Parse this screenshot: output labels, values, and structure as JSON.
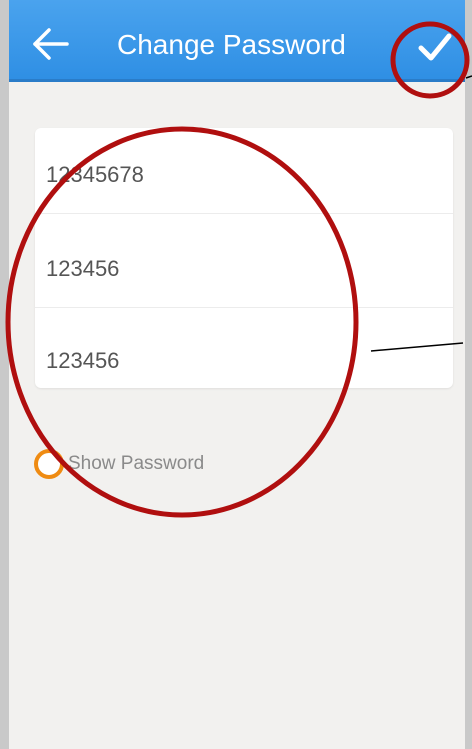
{
  "header": {
    "title": "Change Password",
    "back_icon": "arrow-left-icon",
    "confirm_icon": "check-icon",
    "color": "#3a97e8"
  },
  "form": {
    "fields": [
      {
        "value": "12345678"
      },
      {
        "value": "123456"
      },
      {
        "value": "123456"
      }
    ]
  },
  "show_password": {
    "label": "Show Password",
    "checked": false,
    "accent": "#ef8b12"
  },
  "annotation": {
    "color": "#b00f0f"
  }
}
